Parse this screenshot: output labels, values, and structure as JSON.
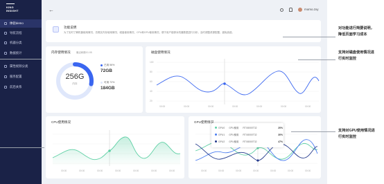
{
  "sidebar": {
    "logo_top": "KING",
    "logo_bottom": "INSIGHT",
    "items": [
      {
        "label": "体验demo",
        "active": true
      },
      {
        "label": "导航流程"
      },
      {
        "label": "机器分类"
      },
      {
        "label": "数据统计"
      },
      {
        "label": "属性视频分类"
      },
      {
        "label": "服务配置"
      },
      {
        "label": "前后关系"
      }
    ]
  },
  "header": {
    "back": "←",
    "username": "momo.zxy"
  },
  "notice": {
    "title": "功能说明",
    "text": "为了实时了解机器使用情况，仿照实内存使用情况、磁盘使用情况、CPU和GPU使用情况，便于用户能够对机器数据进行分析，及时调整资源配置，避免浪费。"
  },
  "memory": {
    "title": "内存使用情况",
    "subtitle": "最近刷新01:05",
    "total": "256G",
    "total_label": "内存",
    "used_label": "已用 56%",
    "used_value": "72GB",
    "free_label": "可用 72%",
    "free_value": "184GB",
    "used_color": "#3a66f0",
    "free_color": "#dfe7fb",
    "used_fraction": 0.28
  },
  "disk": {
    "title": "磁盘使用情况",
    "ylabels": [
      "100",
      "80",
      "60",
      "40",
      "20"
    ],
    "xlabels": [
      "00:00",
      "00:00",
      "00:00",
      "00:00",
      "00:00",
      "00:00",
      "00:00"
    ]
  },
  "cpu": {
    "title": "CPU使用情况",
    "xlabels": [
      "00:00",
      "00:00",
      "00:00",
      "00:00",
      "00:00",
      "00:00",
      "00:00"
    ]
  },
  "gpu": {
    "title": "GPU使用情况",
    "xlabels": [
      "00:00",
      "00:00",
      "00:00",
      "00:00",
      "00:00",
      "00:00",
      "00:00"
    ],
    "tooltip": [
      {
        "name": "GPU0",
        "label": "GPU使用",
        "model": "RTX8000T32",
        "value": "20%",
        "color": "#5fd0a5"
      },
      {
        "name": "GPU1",
        "label": "GPU使用",
        "model": "RTX8000T32",
        "value": "30%",
        "color": "#4a7cf0"
      },
      {
        "name": "GPU2",
        "label": "GPU使用",
        "model": "RTX8000T32",
        "value": "47%",
        "color": "#243a8c"
      }
    ]
  },
  "annotations": [
    {
      "lines": [
        "对功能进行简要说明，",
        "降低页面学习成本"
      ]
    },
    {
      "lines": [
        "支持对磁盘使用情况进",
        "行实时监控"
      ]
    },
    {
      "lines": [
        "支持对GPU使用情况进",
        "行实时监控"
      ]
    }
  ]
}
